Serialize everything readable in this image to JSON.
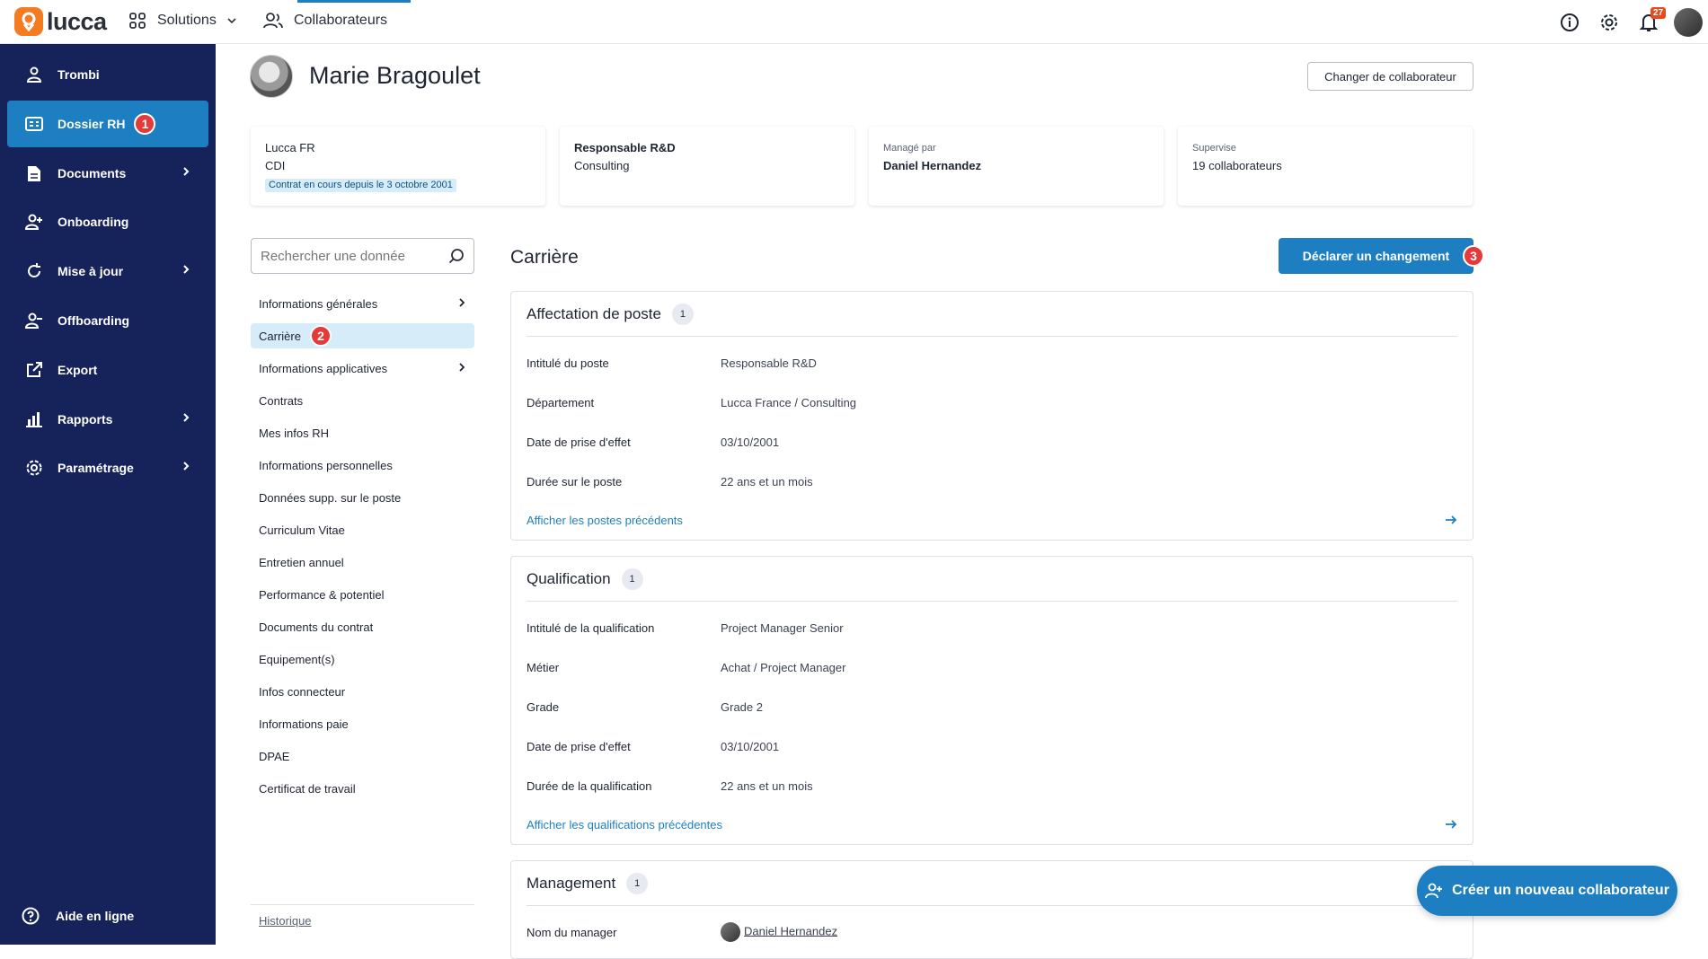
{
  "app": {
    "logo_text": "lucca",
    "solutions_label": "Solutions",
    "current_app_label": "Collaborateurs",
    "notifications_count": "27"
  },
  "sidebar": {
    "items": [
      {
        "label": "Trombi",
        "icon": "person-icon"
      },
      {
        "label": "Dossier RH",
        "icon": "id-card-icon",
        "active": true,
        "marker": "1"
      },
      {
        "label": "Documents",
        "icon": "document-icon",
        "has_children": true
      },
      {
        "label": "Onboarding",
        "icon": "person-add-icon"
      },
      {
        "label": "Mise à jour",
        "icon": "refresh-icon",
        "has_children": true
      },
      {
        "label": "Offboarding",
        "icon": "person-remove-icon"
      },
      {
        "label": "Export",
        "icon": "export-icon"
      },
      {
        "label": "Rapports",
        "icon": "bar-chart-icon",
        "has_children": true
      },
      {
        "label": "Paramétrage",
        "icon": "gear-icon",
        "has_children": true
      }
    ],
    "help_label": "Aide en ligne"
  },
  "employee": {
    "name": "Marie Bragoulet",
    "change_button": "Changer de collaborateur",
    "cards": {
      "company": "Lucca FR",
      "contract_type": "CDI",
      "contract_tag": "Contrat en cours depuis le 3 octobre 2001",
      "job_title": "Responsable R&D",
      "department": "Consulting",
      "managed_by_label": "Managé par",
      "manager": "Daniel Hernandez",
      "supervises_label": "Supervise",
      "supervises_value": "19 collaborateurs"
    }
  },
  "search": {
    "placeholder": "Rechercher une donnée"
  },
  "nav": {
    "items": [
      {
        "label": "Informations générales",
        "has_children": true
      },
      {
        "label": "Carrière",
        "active": true,
        "marker": "2"
      },
      {
        "label": "Informations applicatives",
        "has_children": true
      },
      {
        "label": "Contrats"
      },
      {
        "label": "Mes infos RH"
      },
      {
        "label": "Informations personnelles"
      },
      {
        "label": "Données supp. sur le poste"
      },
      {
        "label": "Curriculum Vitae"
      },
      {
        "label": "Entretien annuel"
      },
      {
        "label": "Performance & potentiel"
      },
      {
        "label": "Documents du contrat"
      },
      {
        "label": "Equipement(s)"
      },
      {
        "label": "Infos connecteur"
      },
      {
        "label": "Informations paie"
      },
      {
        "label": "DPAE"
      },
      {
        "label": "Certificat de travail"
      }
    ],
    "history_label": "Historique"
  },
  "content": {
    "title": "Carrière",
    "declare_button": "Déclarer un changement",
    "declare_marker": "3",
    "affectation": {
      "title": "Affectation de poste",
      "count": "1",
      "rows": [
        {
          "label": "Intitulé du poste",
          "value": "Responsable R&D"
        },
        {
          "label": "Département",
          "value": "Lucca France / Consulting"
        },
        {
          "label": "Date de prise d'effet",
          "value": "03/10/2001"
        },
        {
          "label": "Durée sur le poste",
          "value": "22 ans et un mois"
        }
      ],
      "link": "Afficher les postes précédents"
    },
    "qualification": {
      "title": "Qualification",
      "count": "1",
      "rows": [
        {
          "label": "Intitulé de la qualification",
          "value": "Project Manager Senior"
        },
        {
          "label": "Métier",
          "value": "Achat / Project Manager"
        },
        {
          "label": "Grade",
          "value": "Grade 2"
        },
        {
          "label": "Date de prise d'effet",
          "value": "03/10/2001"
        },
        {
          "label": "Durée de la qualification",
          "value": "22 ans et un mois"
        }
      ],
      "link": "Afficher les qualifications précédentes"
    },
    "management": {
      "title": "Management",
      "count": "1",
      "manager_label": "Nom du manager",
      "manager_value": "Daniel Hernandez"
    }
  },
  "fab_label": "Créer un nouveau collaborateur"
}
